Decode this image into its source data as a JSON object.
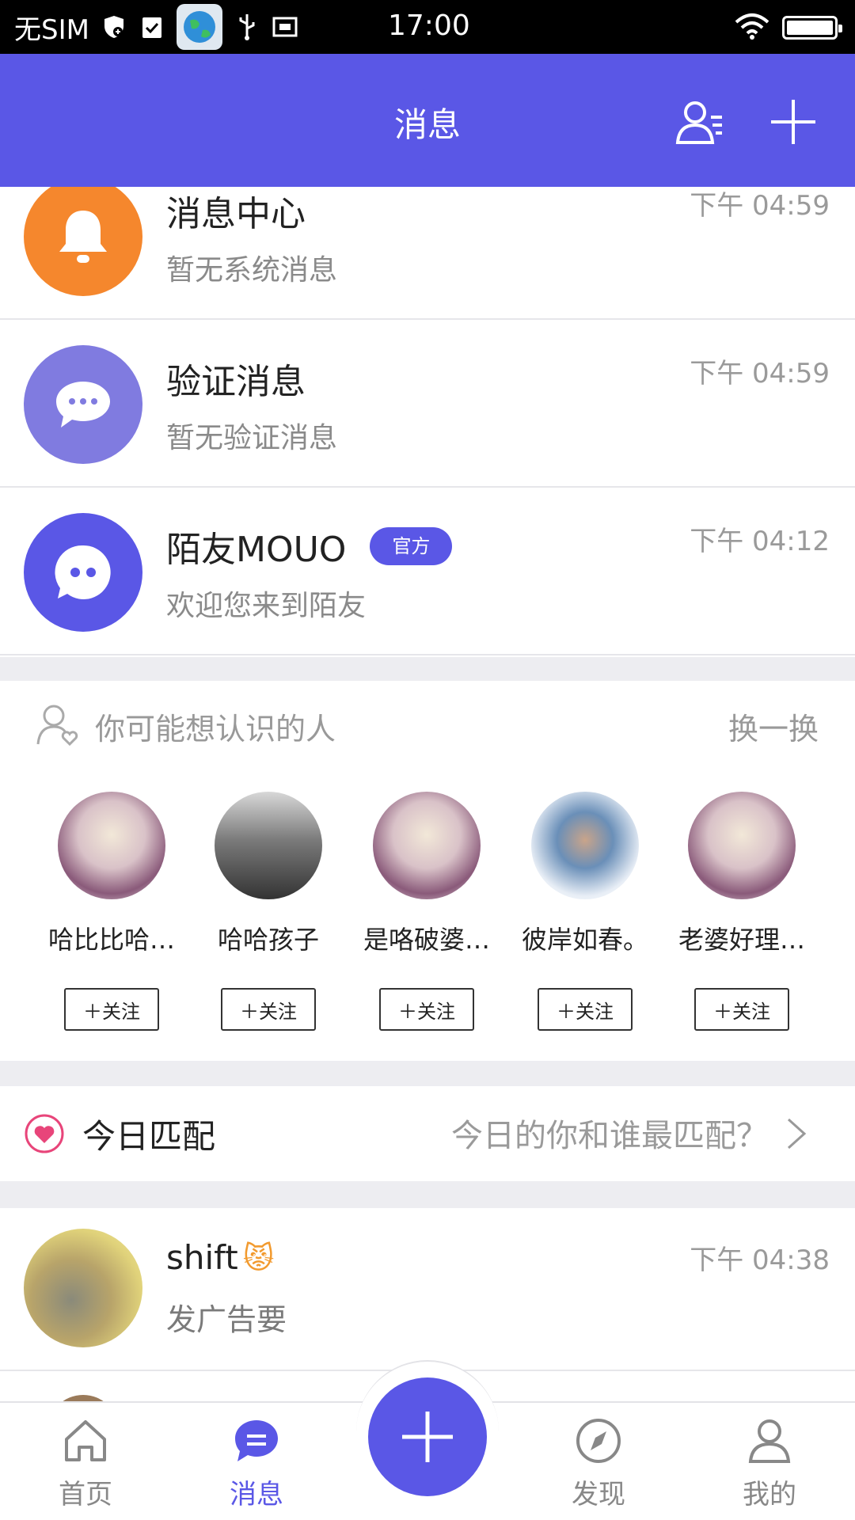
{
  "status_bar": {
    "carrier": "无SIM",
    "time": "17:00"
  },
  "header": {
    "title": "消息",
    "accent_color": "#5a57e6",
    "contacts_icon": "contacts-icon",
    "add_icon": "plus-icon"
  },
  "system_items": [
    {
      "title": "消息中心",
      "subtitle": "暂无系统消息",
      "time": "下午 04:59",
      "icon": "bell-icon",
      "color": "#f5872d"
    },
    {
      "title": "验证消息",
      "subtitle": "暂无验证消息",
      "time": "下午 04:59",
      "icon": "chat-bubble-icon",
      "color": "#807be0"
    },
    {
      "title": "陌友MOUO",
      "badge": "官方",
      "subtitle": "欢迎您来到陌友",
      "time": "下午 04:12",
      "icon": "mouo-logo-icon",
      "color": "#5a57e6"
    }
  ],
  "suggest": {
    "title": "你可能想认识的人",
    "refresh": "换一换",
    "people": [
      {
        "name": "哈比比哈…",
        "follow": "关注"
      },
      {
        "name": "哈哈孩子",
        "follow": "关注"
      },
      {
        "name": "是咯破婆…",
        "follow": "关注"
      },
      {
        "name": "彼岸如春。",
        "follow": "关注"
      },
      {
        "name": "老婆好理…",
        "follow": "关注"
      }
    ]
  },
  "match": {
    "title": "今日匹配",
    "subtitle": "今日的你和谁最匹配？"
  },
  "chats": [
    {
      "name": "shift",
      "emoji": "😾",
      "preview": "发广告要",
      "time": "下午 04:38"
    }
  ],
  "bottom_nav": {
    "items": [
      {
        "label": "首页",
        "icon": "home-icon"
      },
      {
        "label": "消息",
        "icon": "message-icon"
      },
      {
        "label": "发现",
        "icon": "compass-icon"
      },
      {
        "label": "我的",
        "icon": "profile-icon"
      }
    ]
  }
}
